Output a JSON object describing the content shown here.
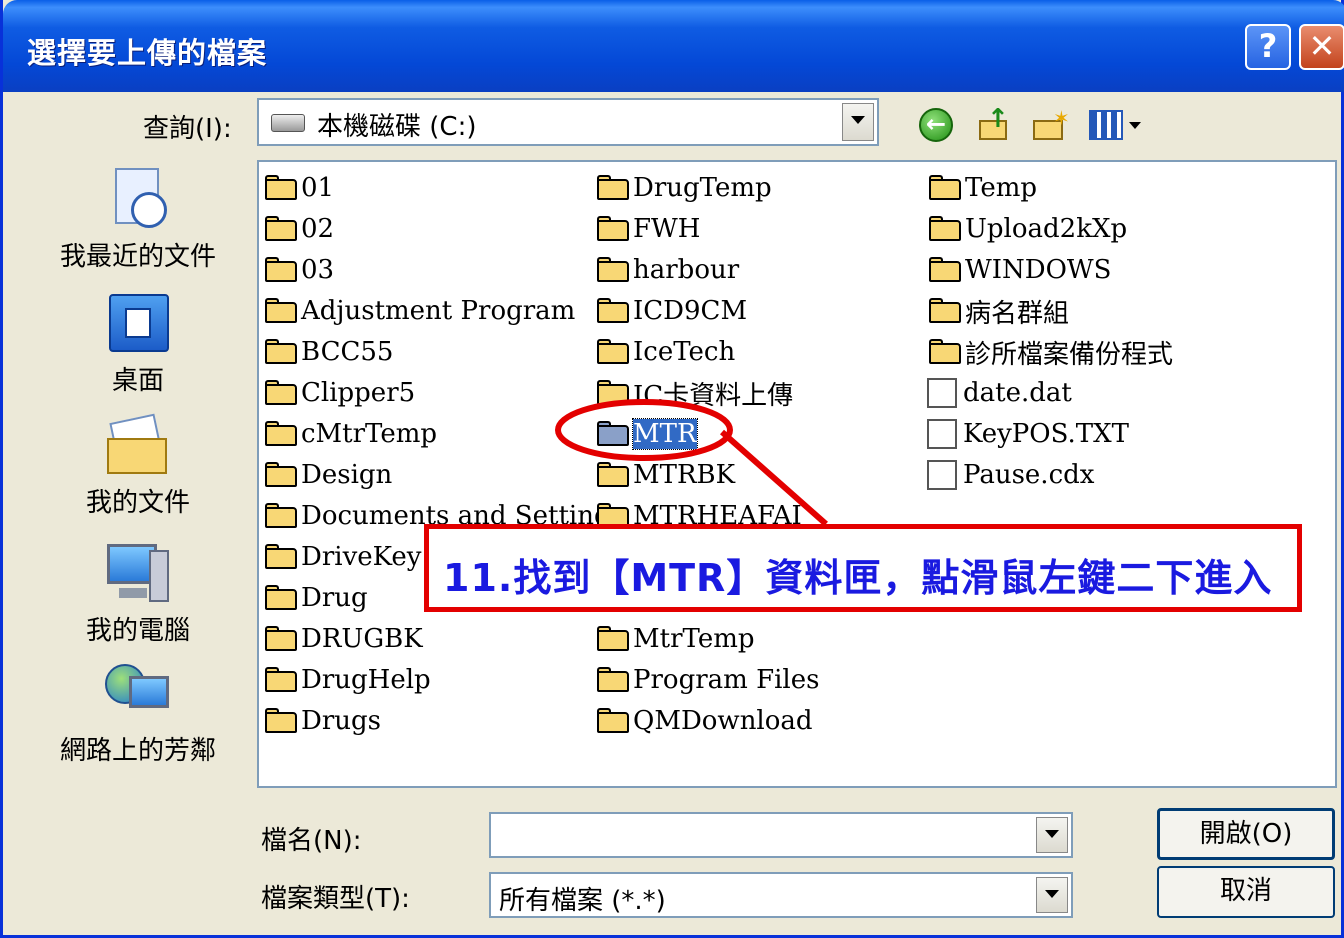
{
  "window": {
    "title": "選擇要上傳的檔案",
    "help_label": "?",
    "close_label": "✕"
  },
  "lookin": {
    "label": "查詢(I):",
    "value": "本機磁碟 (C:)"
  },
  "toolbar": {
    "icons": [
      "back-icon",
      "up-folder-icon",
      "new-folder-icon",
      "view-menu-icon"
    ]
  },
  "places": [
    "我最近的文件",
    "桌面",
    "我的文件",
    "我的電腦",
    "網路上的芳鄰"
  ],
  "files": {
    "col1": [
      "01",
      "02",
      "03",
      "Adjustment Program",
      "BCC55",
      "Clipper5",
      "cMtrTemp",
      "Design",
      "Documents and Settings",
      "DriveKey",
      "Drug",
      "DRUGBK",
      "DrugHelp",
      "Drugs"
    ],
    "col2": [
      "DrugTemp",
      "FWH",
      "harbour",
      "ICD9CM",
      "IceTech",
      "IC卡資料上傳",
      "MTR",
      "MTRBK",
      "MTRHEAFAI",
      "",
      "",
      "MtrTemp",
      "Program Files",
      "QMDownload"
    ],
    "col3_folders": [
      "Temp",
      "Upload2kXp",
      "WINDOWS",
      "病名群組",
      "診所檔案備份程式"
    ],
    "col3_files": [
      "date.dat",
      "KeyPOS.TXT",
      "Pause.cdx"
    ],
    "selected": "MTR"
  },
  "filename": {
    "label": "檔名(N):",
    "value": ""
  },
  "filetype": {
    "label": "檔案類型(T):",
    "value": "所有檔案 (*.*)"
  },
  "buttons": {
    "open": "開啟(O)",
    "cancel": "取消"
  },
  "annotation": {
    "text": "11.找到【MTR】資料匣，點滑鼠左鍵二下進入",
    "color": "#e30000",
    "text_color": "#1a1ae0"
  },
  "colors": {
    "titlebar": "#0a4fd8",
    "dialog": "#ece9d8",
    "selection": "#316ac5"
  }
}
